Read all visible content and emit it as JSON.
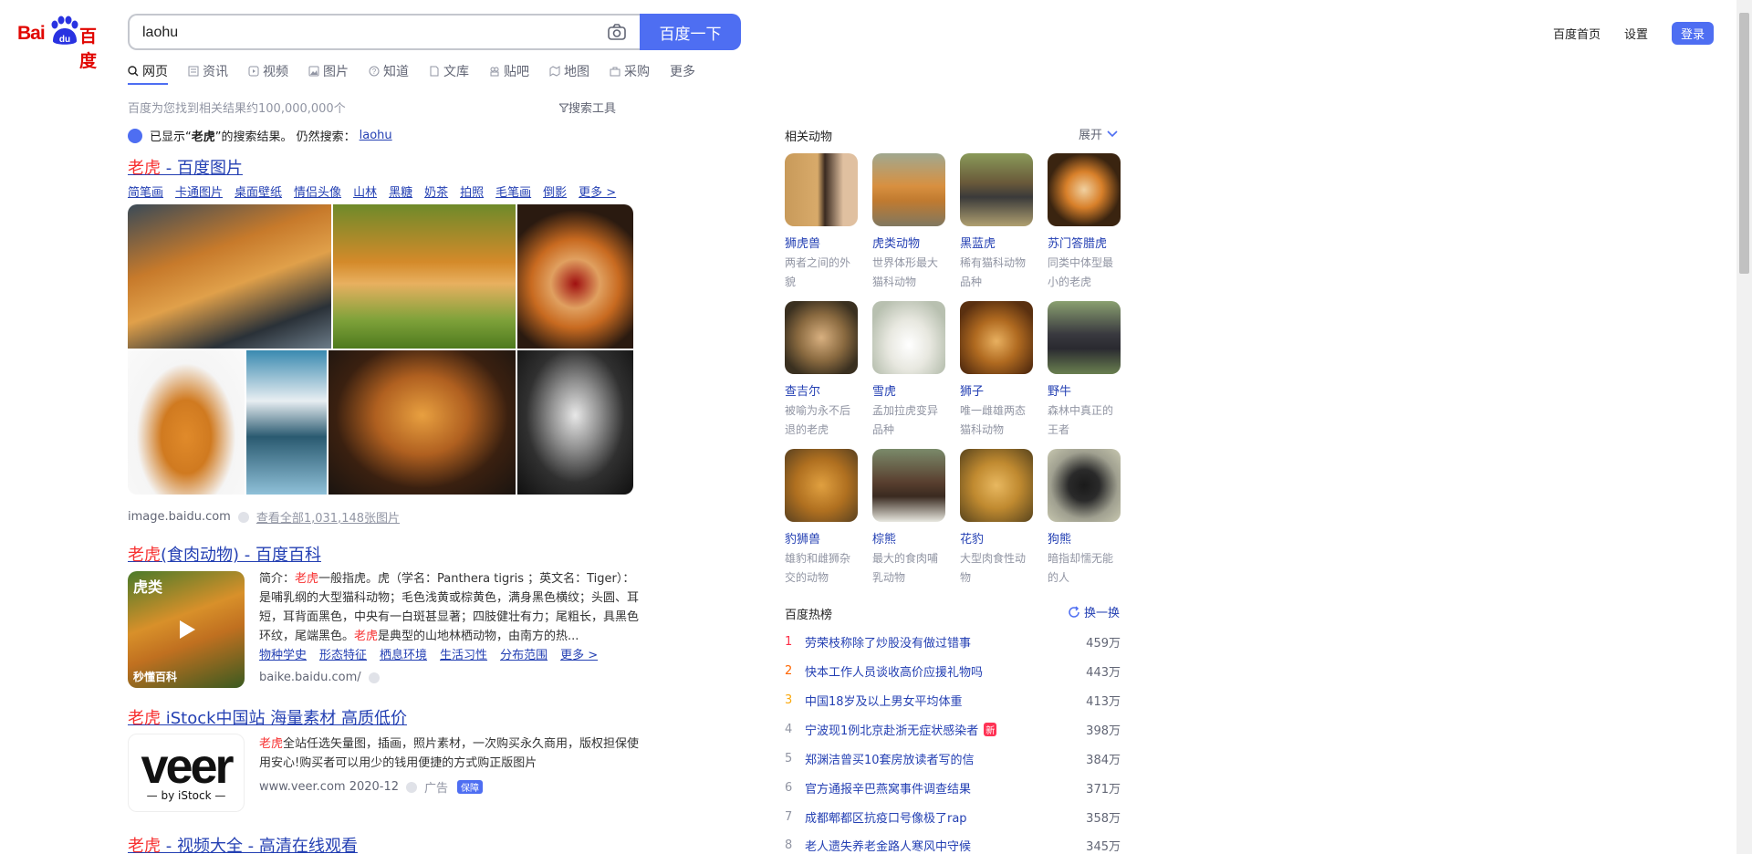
{
  "logo": {
    "bai": "Bai",
    "du": "du",
    "cn": "百度"
  },
  "search": {
    "query": "laohu",
    "button": "百度一下"
  },
  "top_links": {
    "home": "百度首页",
    "settings": "设置",
    "login": "登录"
  },
  "tabs": [
    "网页",
    "资讯",
    "视频",
    "图片",
    "知道",
    "文库",
    "贴吧",
    "地图",
    "采购",
    "更多"
  ],
  "result_count": "百度为您找到相关结果约100,000,000个",
  "search_tools": "搜索工具",
  "notice": {
    "prefix": "已显示“",
    "term": "老虎",
    "suffix": "”的搜索结果。 仍然搜索：",
    "alt": "laohu"
  },
  "image_result": {
    "title_em": "老虎",
    "title_rest": " - 百度图片",
    "subs": [
      "简笔画",
      "卡通图片",
      "桌面壁纸",
      "情侣头像",
      "山林",
      "黑糖",
      "奶茶",
      "拍照",
      "毛笔画",
      "倒影",
      "更多 >"
    ],
    "source": "image.baidu.com",
    "more": "查看全部1,031,148张图片"
  },
  "baike_result": {
    "title_em": "老虎",
    "title_rest": "(食肉动物) - 百度百科",
    "text1": "简介：",
    "em1": "老虎",
    "text2": "一般指虎。虎（学名：Panthera tigris ；英文名：Tiger）：是哺乳纲的大型猫科动物；毛色浅黄或棕黄色，满身黑色横纹；头圆、耳短，耳背面黑色，中央有一白斑甚显著；四肢健壮有力；尾粗长，具黑色环纹，尾端黑色。",
    "em2": "老虎",
    "text3": "是典型的山地林栖动物，由南方的热...",
    "thumb_label": "虎类",
    "thumb_brand": "秒懂百科",
    "links": [
      "物种学史",
      "形态特征",
      "栖息环境",
      "生活习性",
      "分布范围",
      "更多 >"
    ],
    "source": "baike.baidu.com/"
  },
  "veer_result": {
    "title_em": "老虎",
    "title_rest": " iStock中国站 海量素材 高质低价",
    "em": "老虎",
    "text": "全站任选矢量图，插画，照片素材，一次购买永久商用，版权担保使用安心!购买者可以用少的钱用便捷的方式购正版图片",
    "logo_big": "veer",
    "logo_small": "— by iStock —",
    "source": "www.veer.com 2020-12",
    "ad": "广告",
    "guard": "保障"
  },
  "video_result": {
    "title_em": "老虎",
    "title_rest": " - 视频大全 - 高清在线观看"
  },
  "related": {
    "title": "相关动物",
    "expand": "展开",
    "animals": [
      {
        "name": "狮虎兽",
        "desc": "两者之间的外貌"
      },
      {
        "name": "虎类动物",
        "desc": "世界体形最大猫科动物"
      },
      {
        "name": "黑蓝虎",
        "desc": "稀有猫科动物品种"
      },
      {
        "name": "苏门答腊虎",
        "desc": "同类中体型最小的老虎"
      },
      {
        "name": "查吉尔",
        "desc": "被喻为永不后退的老虎"
      },
      {
        "name": "雪虎",
        "desc": "孟加拉虎变异品种"
      },
      {
        "name": "狮子",
        "desc": "唯一雌雄两态猫科动物"
      },
      {
        "name": "野牛",
        "desc": "森林中真正的王者"
      },
      {
        "name": "豹狮兽",
        "desc": "雄豹和雌狮杂交的动物"
      },
      {
        "name": "棕熊",
        "desc": "最大的食肉哺乳动物"
      },
      {
        "name": "花豹",
        "desc": "大型肉食性动物"
      },
      {
        "name": "狗熊",
        "desc": "暗指却懦无能的人"
      }
    ]
  },
  "hot": {
    "title": "百度热榜",
    "refresh": "换一换",
    "new_badge": "新",
    "items": [
      {
        "rank": "1",
        "text": "劳荣枝称除了炒股没有做过错事",
        "heat": "459万"
      },
      {
        "rank": "2",
        "text": "快本工作人员谈收高价应援礼物吗",
        "heat": "443万"
      },
      {
        "rank": "3",
        "text": "中国18岁及以上男女平均体重",
        "heat": "413万"
      },
      {
        "rank": "4",
        "text": "宁波现1例北京赴浙无症状感染者",
        "heat": "398万"
      },
      {
        "rank": "5",
        "text": "郑渊洁曾买10套房放读者写的信",
        "heat": "384万"
      },
      {
        "rank": "6",
        "text": "官方通报辛巴燕窝事件调查结果",
        "heat": "371万"
      },
      {
        "rank": "7",
        "text": "成都郫都区抗疫口号像极了rap",
        "heat": "358万"
      },
      {
        "rank": "8",
        "text": "老人遗失养老金路人寒风中守候",
        "heat": "345万"
      }
    ]
  },
  "colors": {
    "brand_blue": "#4e6ef2",
    "link_blue": "#2440b3",
    "highlight_red": "#f73131",
    "logo_red": "#e10601"
  }
}
